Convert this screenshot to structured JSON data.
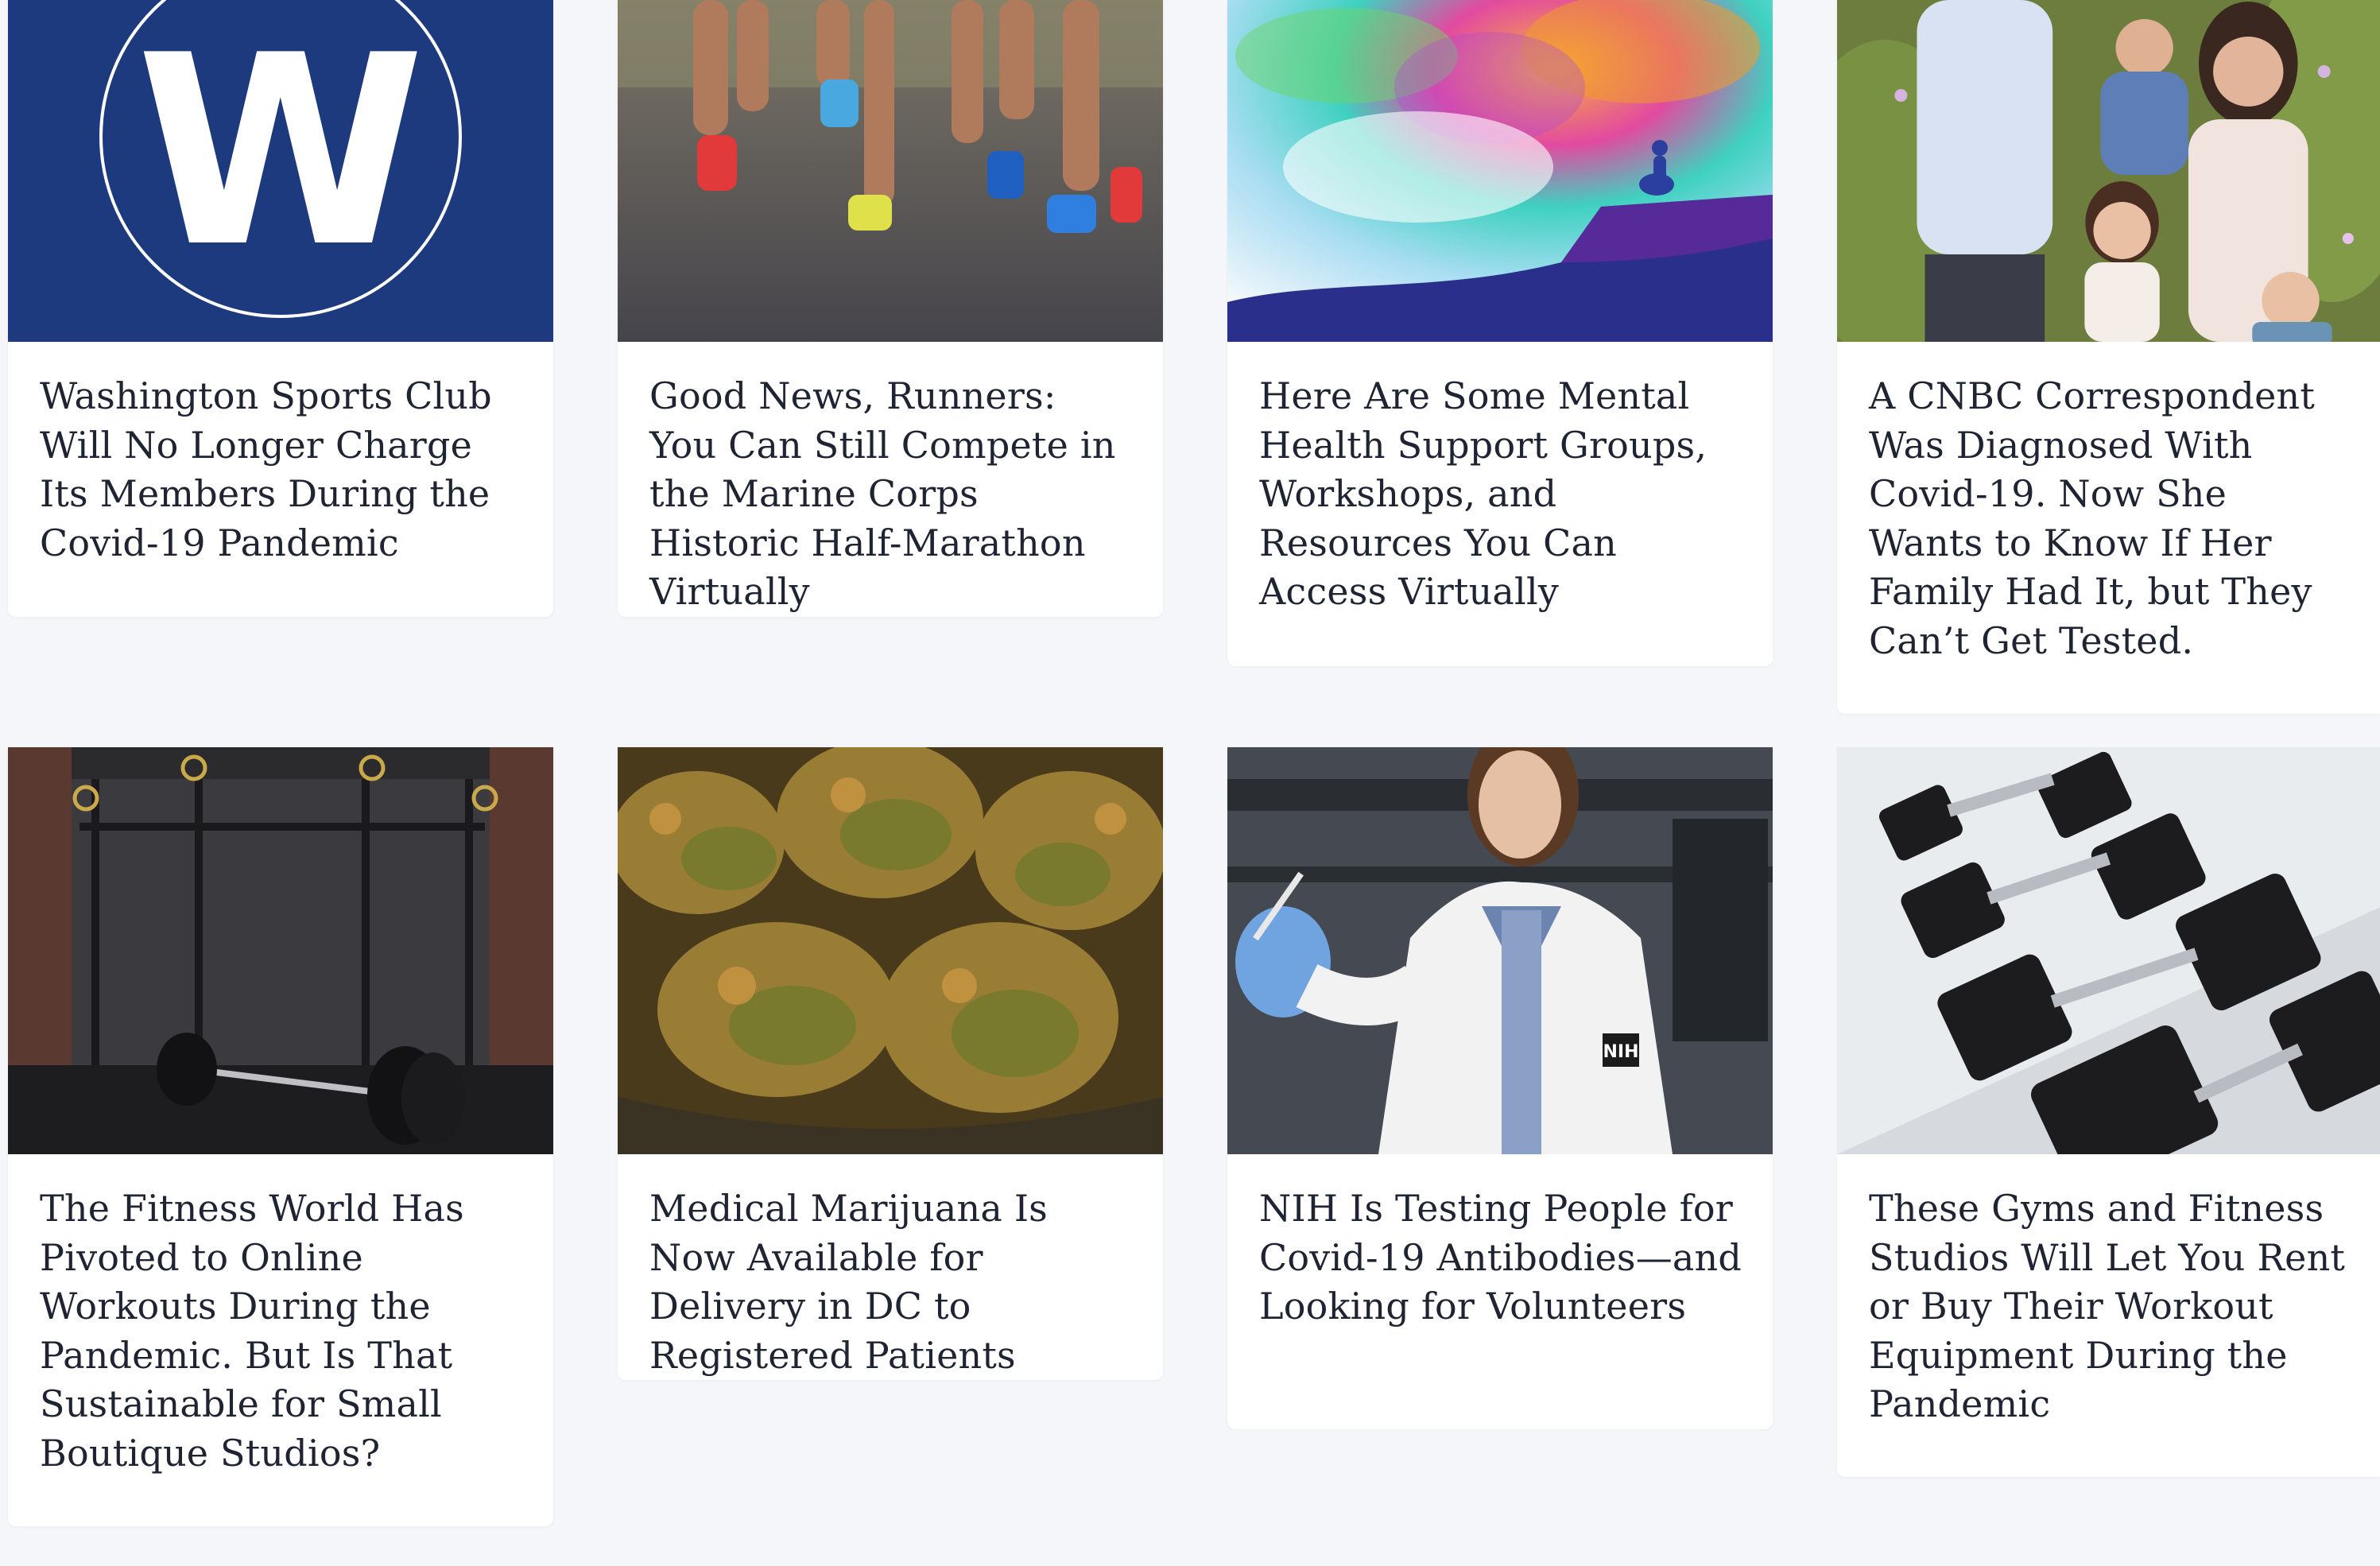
{
  "articles": [
    {
      "title": "Washington Sports Club Will No Longer Charge Its Members During the Covid-19 Pandemic",
      "image": "washingtonian-w-logo",
      "logo_letter": "W"
    },
    {
      "title": "Good News, Runners: You Can Still Compete in the Marine Corps Historic Half-Marathon Virtually",
      "image": "runners-legs-photo"
    },
    {
      "title": "Here Are Some Mental Health Support Groups, Workshops, and Resources You Can Access Virtually",
      "image": "watercolor-meditation-illustration"
    },
    {
      "title": "A CNBC Correspondent Was Diagnosed With Covid-19. Now She Wants to Know If Her Family Had It, but They Can’t Get Tested.",
      "image": "family-portrait-photo"
    },
    {
      "title": "The Fitness World Has Pivoted to Online Workouts During the Pandemic. But Is That Sustainable for Small Boutique Studios?",
      "image": "empty-gym-barbell-photo"
    },
    {
      "title": "Medical Marijuana Is Now Available for Delivery in DC to Registered Patients",
      "image": "cannabis-buds-photo"
    },
    {
      "title": "NIH Is Testing People for Covid-19 Antibodies—and Looking for Volunteers",
      "image": "nih-scientist-photo",
      "coat_badge": "NIH"
    },
    {
      "title": "These Gyms and Fitness Studios Will Let You Rent or Buy Their Workout Equipment During the Pandemic",
      "image": "dumbbell-rack-photo"
    }
  ],
  "colors": {
    "page_bg": "#f5f6fa",
    "card_bg": "#ffffff",
    "title_text": "#1f2433",
    "logo_blue": "#1d3a7e"
  }
}
